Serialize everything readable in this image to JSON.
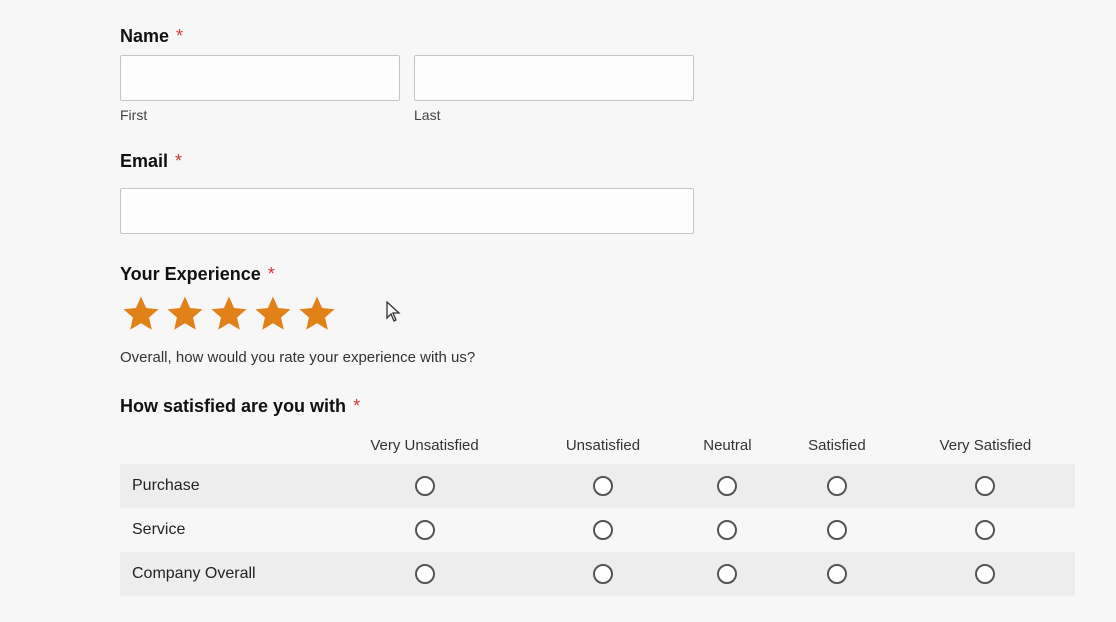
{
  "name": {
    "label": "Name",
    "first_sublabel": "First",
    "last_sublabel": "Last",
    "first_value": "",
    "last_value": ""
  },
  "email": {
    "label": "Email",
    "value": ""
  },
  "experience": {
    "label": "Your Experience",
    "description": "Overall, how would you rate your experience with us?",
    "rating": 5,
    "star_color": "#e0811a"
  },
  "satisfaction": {
    "label": "How satisfied are you with",
    "columns": [
      "Very Unsatisfied",
      "Unsatisfied",
      "Neutral",
      "Satisfied",
      "Very Satisfied"
    ],
    "rows": [
      "Purchase",
      "Service",
      "Company Overall"
    ]
  },
  "required_marker": "*"
}
